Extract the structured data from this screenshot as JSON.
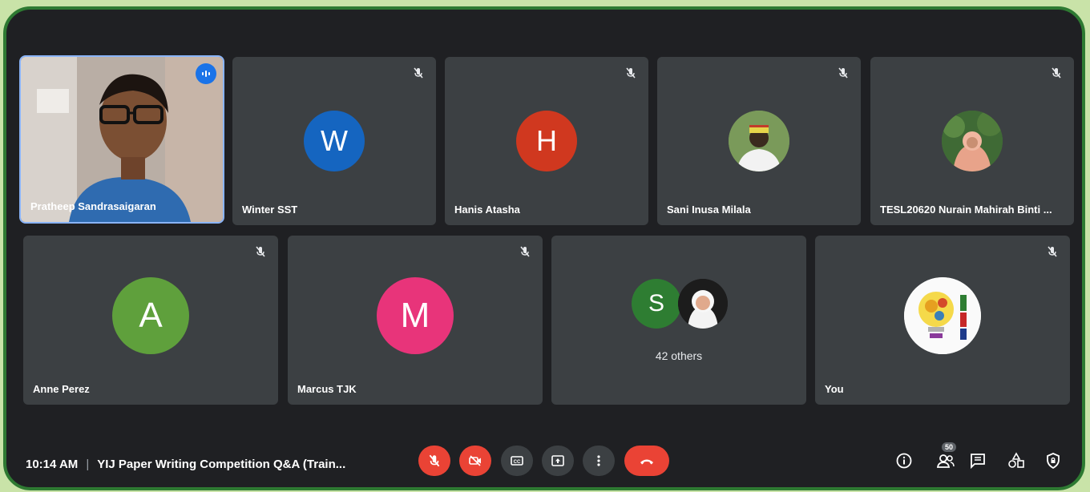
{
  "tiles": [
    {
      "name": "Pratheep Sandrasaigaran",
      "speaking": true
    },
    {
      "name": "Winter SST",
      "initial": "W",
      "color": "#1565c0"
    },
    {
      "name": "Hanis Atasha",
      "initial": "H",
      "color": "#d0381f"
    },
    {
      "name": "Sani Inusa Milala"
    },
    {
      "name": "TESL20620 Nurain Mahirah Binti ..."
    },
    {
      "name": "Anne Perez",
      "initial": "A",
      "color": "#5fa03c"
    },
    {
      "name": "Marcus TJK",
      "initial": "M",
      "color": "#e8347a"
    },
    {
      "initial": "S",
      "color": "#2e7d32",
      "others_label": "42 others"
    },
    {
      "name": "You"
    }
  ],
  "bottom": {
    "time": "10:14 AM",
    "separator": "|",
    "meeting_title": "YIJ Paper Writing Competition Q&A (Train..."
  },
  "controls": [
    "mic-off",
    "camera-off",
    "captions",
    "present",
    "more-options",
    "leave-call"
  ],
  "right_icons": {
    "people_count": "50"
  },
  "colors": {
    "danger": "#ea4335",
    "frame_border": "#2e7a32",
    "tile_bg": "#3c4043",
    "page_bg": "#1f2023"
  }
}
